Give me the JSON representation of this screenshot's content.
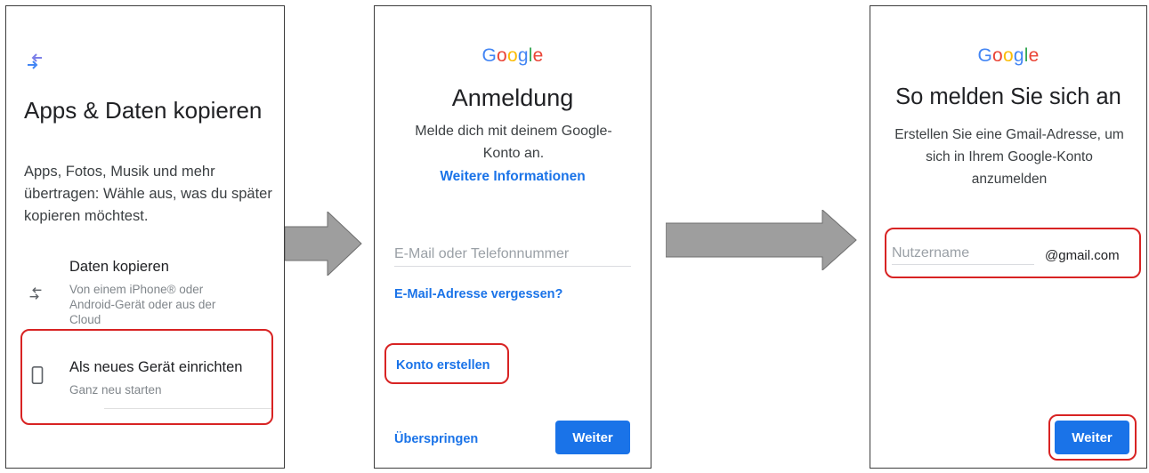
{
  "screen1": {
    "title": "Apps & Daten kopieren",
    "description": "Apps, Fotos, Musik und mehr übertragen: Wähle aus, was du später kopieren möchtest.",
    "options": [
      {
        "title": "Daten kopieren",
        "subtitle": "Von einem iPhone® oder Android-Gerät oder aus der Cloud",
        "icon": "transfer-arrows-icon"
      },
      {
        "title": "Als neues Gerät einrichten",
        "subtitle": "Ganz neu starten",
        "icon": "phone-icon"
      }
    ]
  },
  "screen2": {
    "logo_letters": [
      "G",
      "o",
      "o",
      "g",
      "l",
      "e"
    ],
    "title": "Anmeldung",
    "subtitle": "Melde dich mit deinem Google-Konto an.",
    "more_info": "Weitere Informationen",
    "email_placeholder": "E-Mail oder Telefonnummer",
    "forgot_email": "E-Mail-Adresse vergessen?",
    "create_account": "Konto erstellen",
    "skip": "Überspringen",
    "next": "Weiter"
  },
  "screen3": {
    "logo_letters": [
      "G",
      "o",
      "o",
      "g",
      "l",
      "e"
    ],
    "title": "So melden Sie sich an",
    "subtitle": "Erstellen Sie eine Gmail-Adresse, um sich in Ihrem Google-Konto anzumelden",
    "username_placeholder": "Nutzername",
    "domain_suffix": "@gmail.com",
    "next": "Weiter"
  },
  "colors": {
    "accent": "#1a73e8",
    "highlight": "#d82323",
    "arrow_fill": "#9e9e9e",
    "google_blue": "#4285F4",
    "google_red": "#EA4335",
    "google_yellow": "#FBBC05",
    "google_green": "#34A853"
  }
}
